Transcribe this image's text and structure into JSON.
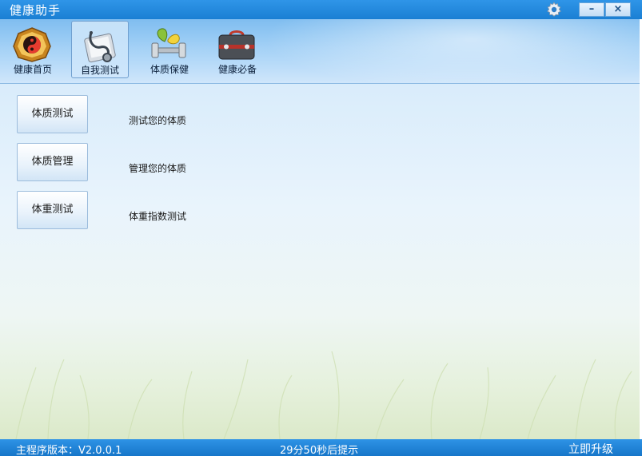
{
  "window": {
    "title": "健康助手"
  },
  "toolbar": {
    "items": [
      {
        "label": "健康首页",
        "icon": "yin-yang-icon",
        "active": false
      },
      {
        "label": "自我测试",
        "icon": "stethoscope-icon",
        "active": true
      },
      {
        "label": "体质保健",
        "icon": "fitness-icon",
        "active": false
      },
      {
        "label": "健康必备",
        "icon": "medical-kit-icon",
        "active": false
      }
    ]
  },
  "window_controls": {
    "minimize_label": "–",
    "close_label": "×"
  },
  "main": {
    "actions": [
      {
        "button": "体质测试",
        "description": "测试您的体质"
      },
      {
        "button": "体质管理",
        "description": "管理您的体质"
      },
      {
        "button": "体重测试",
        "description": "体重指数测试"
      }
    ]
  },
  "status": {
    "version": "主程序版本：V2.0.0.1",
    "countdown": "29分50秒后提示",
    "upgrade": "立即升级"
  },
  "colors": {
    "titlebar": "#1a7fd3",
    "accent": "#2e93e6"
  }
}
